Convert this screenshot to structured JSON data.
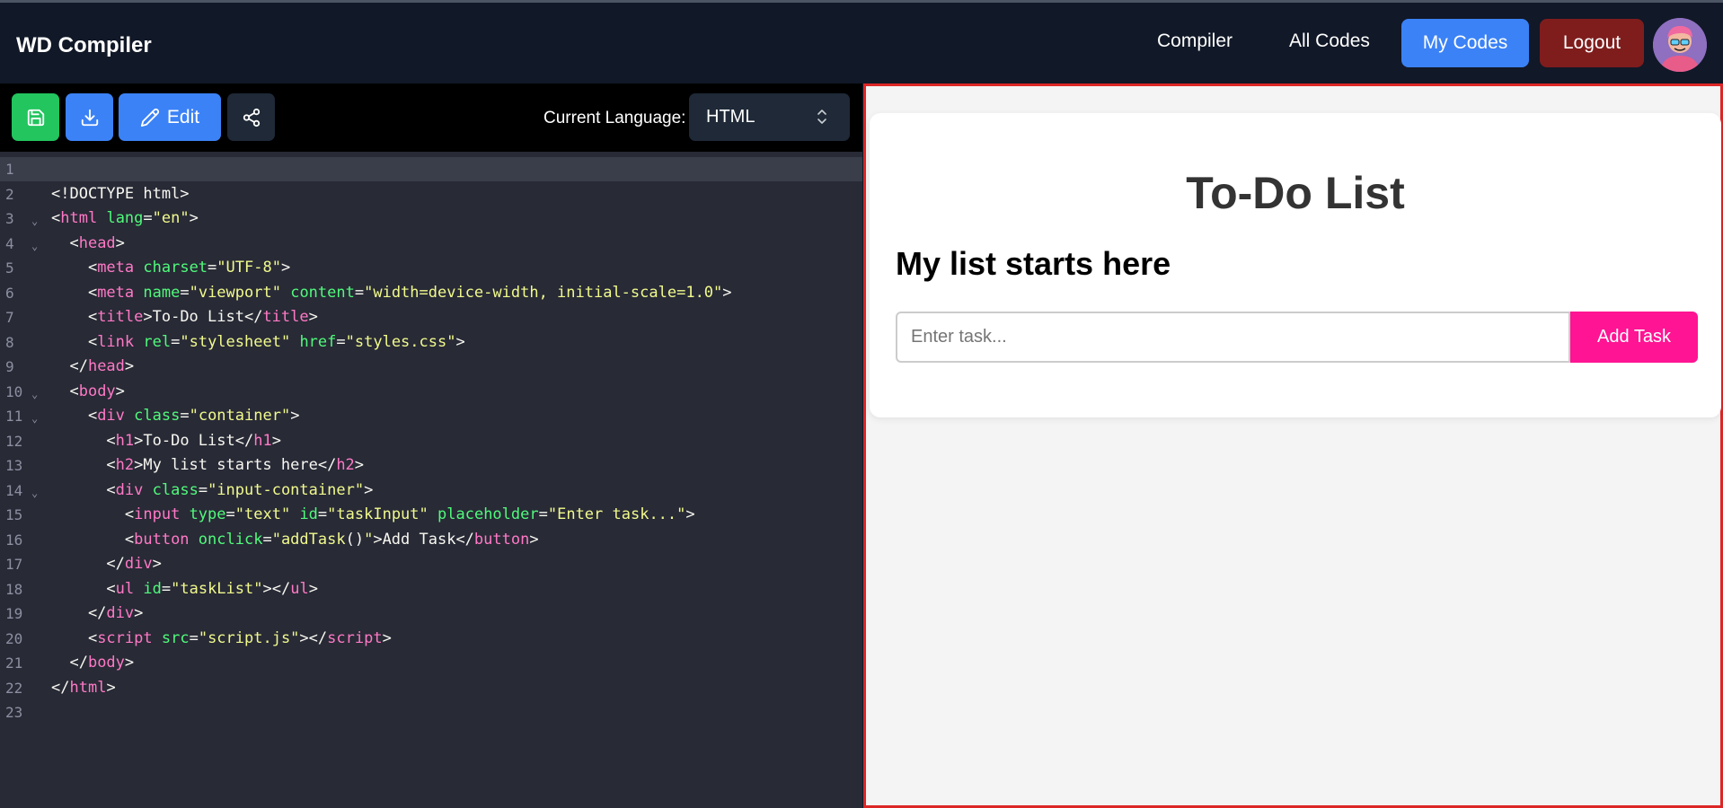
{
  "navbar": {
    "brand": "WD Compiler",
    "links": {
      "compiler": "Compiler",
      "all_codes": "All Codes"
    },
    "my_codes": "My Codes",
    "logout": "Logout",
    "colors": {
      "my_codes": "#3b82f6",
      "logout": "#7f1d1d"
    }
  },
  "toolbar": {
    "edit_label": "Edit",
    "language_label": "Current Language:",
    "language_value": "HTML",
    "icons": [
      "save-icon",
      "download-icon",
      "pencil-icon",
      "share-icon"
    ]
  },
  "editor": {
    "lines": [
      {
        "n": "1",
        "fold": false,
        "html": ""
      },
      {
        "n": "2",
        "fold": false,
        "html": "&lt;!DOCTYPE html&gt;"
      },
      {
        "n": "3",
        "fold": true,
        "html": "&lt;<span class='t'>html</span> <span class='a'>lang</span>=<span class='s'>\"en\"</span>&gt;"
      },
      {
        "n": "4",
        "fold": true,
        "html": "  &lt;<span class='t'>head</span>&gt;"
      },
      {
        "n": "5",
        "fold": false,
        "html": "    &lt;<span class='t'>meta</span> <span class='a'>charset</span>=<span class='s'>\"UTF-8\"</span>&gt;"
      },
      {
        "n": "6",
        "fold": false,
        "html": "    &lt;<span class='t'>meta</span> <span class='a'>name</span>=<span class='s'>\"viewport\"</span> <span class='a'>content</span>=<span class='s'>\"width=device-width, initial-scale=1.0\"</span>&gt;"
      },
      {
        "n": "7",
        "fold": false,
        "html": "    &lt;<span class='t'>title</span>&gt;To-Do List&lt;/<span class='t'>title</span>&gt;"
      },
      {
        "n": "8",
        "fold": false,
        "html": "    &lt;<span class='t'>link</span> <span class='a'>rel</span>=<span class='s'>\"stylesheet\"</span> <span class='a'>href</span>=<span class='s'>\"styles.css\"</span>&gt;"
      },
      {
        "n": "9",
        "fold": false,
        "html": "  &lt;/<span class='t'>head</span>&gt;"
      },
      {
        "n": "10",
        "fold": true,
        "html": "  &lt;<span class='t'>body</span>&gt;"
      },
      {
        "n": "11",
        "fold": true,
        "html": "    &lt;<span class='t'>div</span> <span class='a'>class</span>=<span class='s'>\"container\"</span>&gt;"
      },
      {
        "n": "12",
        "fold": false,
        "html": "      &lt;<span class='t'>h1</span>&gt;To-Do List&lt;/<span class='t'>h1</span>&gt;"
      },
      {
        "n": "13",
        "fold": false,
        "html": "      &lt;<span class='t'>h2</span>&gt;My list starts here&lt;/<span class='t'>h2</span>&gt;"
      },
      {
        "n": "14",
        "fold": true,
        "html": "      &lt;<span class='t'>div</span> <span class='a'>class</span>=<span class='s'>\"input-container\"</span>&gt;"
      },
      {
        "n": "15",
        "fold": false,
        "html": "        &lt;<span class='t'>input</span> <span class='a'>type</span>=<span class='s'>\"text\"</span> <span class='a'>id</span>=<span class='s'>\"taskInput\"</span> <span class='a'>placeholder</span>=<span class='s'>\"Enter task...\"</span>&gt;"
      },
      {
        "n": "16",
        "fold": false,
        "html": "        &lt;<span class='t'>button</span> <span class='a'>onclick</span>=<span class='s'>\"addTask</span>()<span class='s'>\"</span>&gt;Add Task&lt;/<span class='t'>button</span>&gt;"
      },
      {
        "n": "17",
        "fold": false,
        "html": "      &lt;/<span class='t'>div</span>&gt;"
      },
      {
        "n": "18",
        "fold": false,
        "html": "      &lt;<span class='t'>ul</span> <span class='a'>id</span>=<span class='s'>\"taskList\"</span>&gt;&lt;/<span class='t'>ul</span>&gt;"
      },
      {
        "n": "19",
        "fold": false,
        "html": "    &lt;/<span class='t'>div</span>&gt;"
      },
      {
        "n": "20",
        "fold": false,
        "html": "    &lt;<span class='t'>script</span> <span class='a'>src</span>=<span class='s'>\"script.js\"</span>&gt;&lt;/<span class='t'>script</span>&gt;"
      },
      {
        "n": "21",
        "fold": false,
        "html": "  &lt;/<span class='t'>body</span>&gt;"
      },
      {
        "n": "22",
        "fold": false,
        "html": "&lt;/<span class='t'>html</span>&gt;"
      },
      {
        "n": "23",
        "fold": false,
        "html": ""
      }
    ]
  },
  "preview": {
    "title": "To-Do List",
    "subtitle": "My list starts here",
    "input_placeholder": "Enter task...",
    "add_button": "Add Task",
    "colors": {
      "add_button": "#ff1493",
      "border": "#dc2626"
    }
  }
}
